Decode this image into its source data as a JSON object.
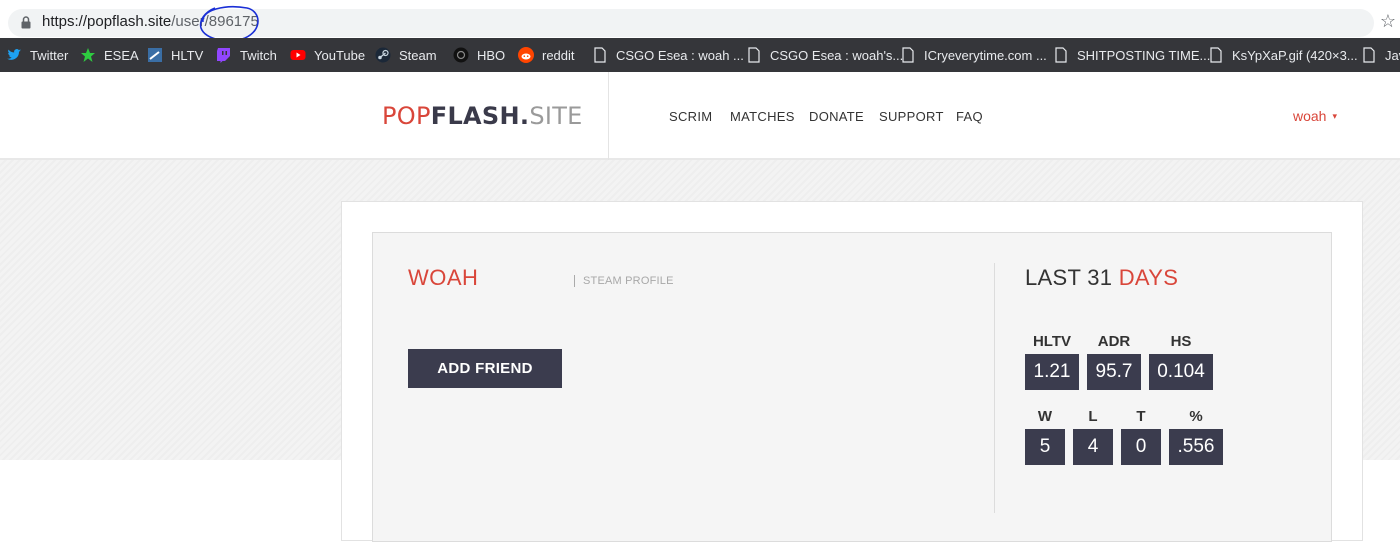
{
  "browser": {
    "url_main": "https://popflash.site",
    "url_path": "/user/",
    "url_id": "896175",
    "bookmarks": [
      {
        "label": "Twitter",
        "icon": "twitter-icon",
        "color": "#1da1f2"
      },
      {
        "label": "ESEA",
        "icon": "esea-icon",
        "color": "#2ecc40"
      },
      {
        "label": "HLTV",
        "icon": "hltv-icon",
        "color": "#3a6ea5"
      },
      {
        "label": "Twitch",
        "icon": "twitch-icon",
        "color": "#9146ff"
      },
      {
        "label": "YouTube",
        "icon": "youtube-icon",
        "color": "#ff0000"
      },
      {
        "label": "Steam",
        "icon": "steam-icon",
        "color": "#c7d5e0"
      },
      {
        "label": "HBO",
        "icon": "hbo-icon",
        "color": "#111111"
      },
      {
        "label": "reddit",
        "icon": "reddit-icon",
        "color": "#ff4500"
      },
      {
        "label": "CSGO Esea : woah ...",
        "icon": "page-icon",
        "color": "#e8eaed"
      },
      {
        "label": "CSGO Esea : woah's...",
        "icon": "page-icon",
        "color": "#e8eaed"
      },
      {
        "label": "ICryeverytime.com ...",
        "icon": "page-icon",
        "color": "#e8eaed"
      },
      {
        "label": "SHITPOSTING TIME...",
        "icon": "page-icon",
        "color": "#e8eaed"
      },
      {
        "label": "KsYpXaP.gif (420×3...",
        "icon": "page-icon",
        "color": "#e8eaed"
      },
      {
        "label": "Jav",
        "icon": "page-icon",
        "color": "#e8eaed"
      }
    ]
  },
  "header": {
    "logo_pop": "POP",
    "logo_flash": "FLASH.",
    "logo_site": "SITE",
    "nav": [
      "SCRIM",
      "MATCHES",
      "DONATE",
      "SUPPORT",
      "FAQ"
    ],
    "user": "woah",
    "caret": "▾"
  },
  "profile": {
    "name": "WOAH",
    "steam_link": "STEAM PROFILE",
    "add_friend": "ADD FRIEND"
  },
  "stats": {
    "heading_prefix": "LAST 31 ",
    "heading_accent": "DAYS",
    "row1": [
      {
        "label": "HLTV",
        "value": "1.21"
      },
      {
        "label": "ADR",
        "value": "95.7"
      },
      {
        "label": "HS",
        "value": "0.104"
      }
    ],
    "row2": [
      {
        "label": "W",
        "value": "5"
      },
      {
        "label": "L",
        "value": "4"
      },
      {
        "label": "T",
        "value": "0"
      },
      {
        "label": "%",
        "value": ".556"
      }
    ]
  },
  "colors": {
    "accent": "#d9463a",
    "dark": "#3b3c4e",
    "annotation": "#1a2fd6"
  }
}
